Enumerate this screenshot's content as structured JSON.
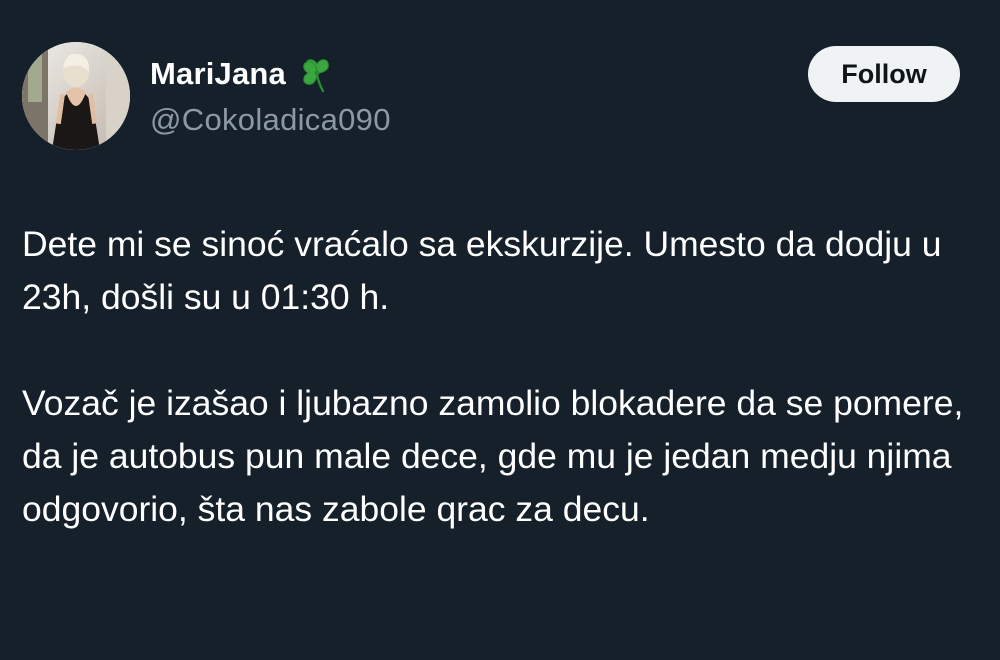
{
  "user": {
    "display_name": "MariJana",
    "handle": "@Cokoladica090",
    "name_emoji": "four-leaf-clover-icon"
  },
  "follow_button": {
    "label": "Follow"
  },
  "tweet": {
    "paragraphs": [
      "Dete mi se sinoć vraćalo sa ekskurzije. Umesto da dodju u 23h, došli su u 01:30 h.",
      "Vozač je izašao i ljubazno zamolio blokadere da se pomere, da je autobus pun male dece, gde mu je jedan medju njima odgovorio, šta nas zabole qrac za decu."
    ]
  },
  "colors": {
    "background": "#15202b",
    "text_primary": "#ffffff",
    "text_secondary": "#8b98a5",
    "button_background": "#eff3f4",
    "button_text": "#0f1419",
    "clover": "#3aa640"
  }
}
